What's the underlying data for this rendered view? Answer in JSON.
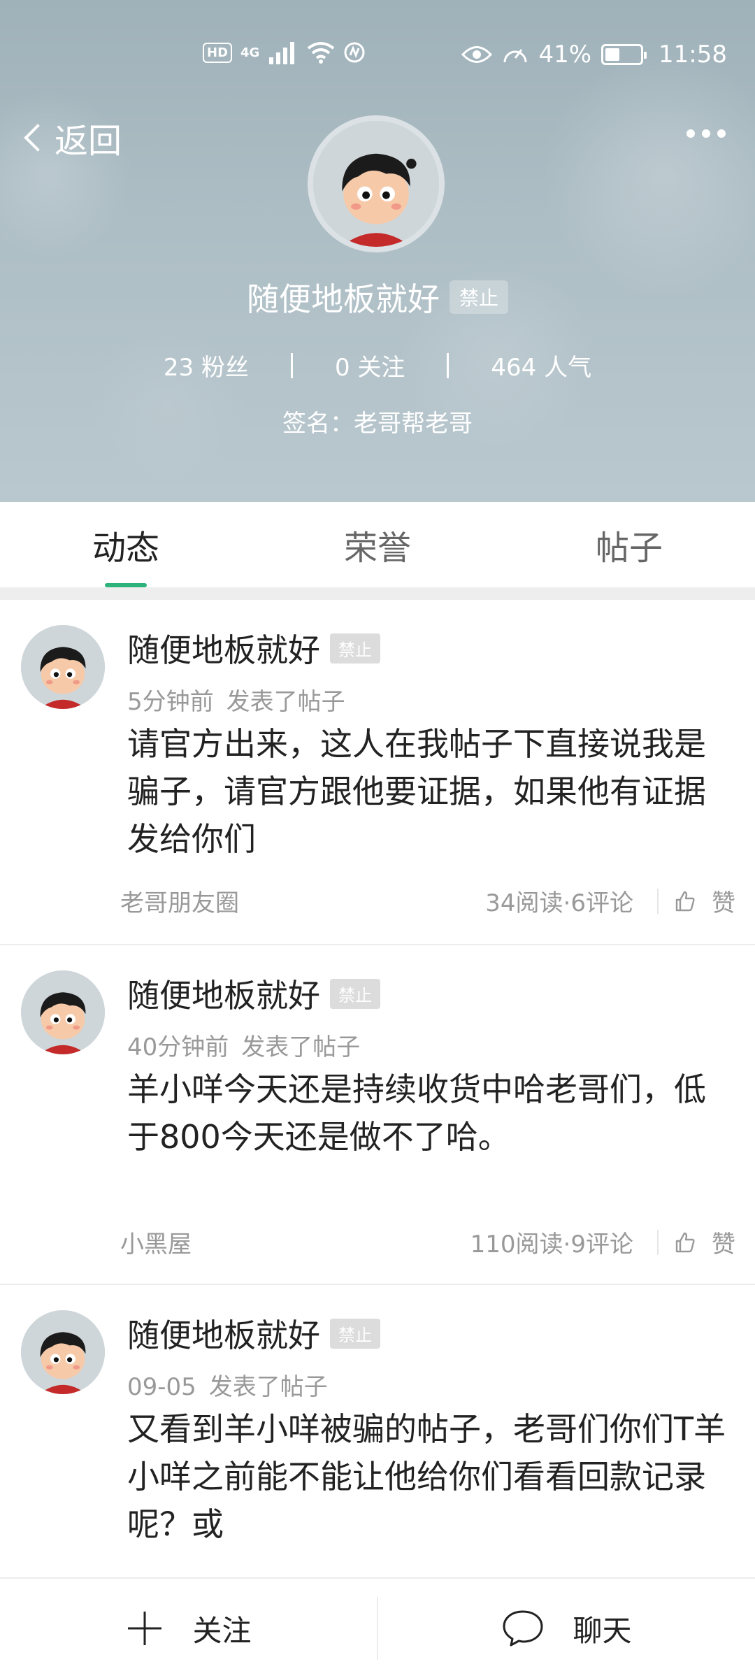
{
  "status_bar": {
    "network_badge": "HD",
    "signal_label": "4G",
    "battery_percent": "41%",
    "battery_level": 0.41,
    "time": "11:58"
  },
  "header": {
    "back_label": "返回",
    "username": "随便地板就好",
    "ban_badge": "禁止",
    "stats": [
      {
        "value": "23",
        "label": "粉丝"
      },
      {
        "value": "0",
        "label": "关注"
      },
      {
        "value": "464",
        "label": "人气"
      }
    ],
    "signature": "签名：老哥帮老哥"
  },
  "tabs": [
    {
      "label": "动态",
      "active": true
    },
    {
      "label": "荣誉",
      "active": false
    },
    {
      "label": "帖子",
      "active": false
    }
  ],
  "posts": [
    {
      "author": "随便地板就好",
      "ban_badge": "禁止",
      "time": "5分钟前",
      "action": "发表了帖子",
      "body": "请官方出来，这人在我帖子下直接说我是骗子，请官方跟他要证据，如果他有证据发给你们",
      "category": "老哥朋友圈",
      "stats": "34阅读·6评论",
      "like_label": "赞"
    },
    {
      "author": "随便地板就好",
      "ban_badge": "禁止",
      "time": "40分钟前",
      "action": "发表了帖子",
      "body": "羊小咩今天还是持续收货中哈老哥们，低于800今天还是做不了哈。",
      "category": "小黑屋",
      "stats": "110阅读·9评论",
      "like_label": "赞"
    },
    {
      "author": "随便地板就好",
      "ban_badge": "禁止",
      "time": "09-05",
      "action": "发表了帖子",
      "body": "又看到羊小咩被骗的帖子，老哥们你们T羊小咩之前能不能让他给你们看看回款记录呢？或",
      "category": "",
      "stats": "",
      "like_label": ""
    }
  ],
  "bottom_bar": {
    "follow_label": "关注",
    "chat_label": "聊天"
  },
  "colors": {
    "accent": "#2db37a",
    "header_bg": "#aebec5",
    "muted_text": "#999999"
  }
}
